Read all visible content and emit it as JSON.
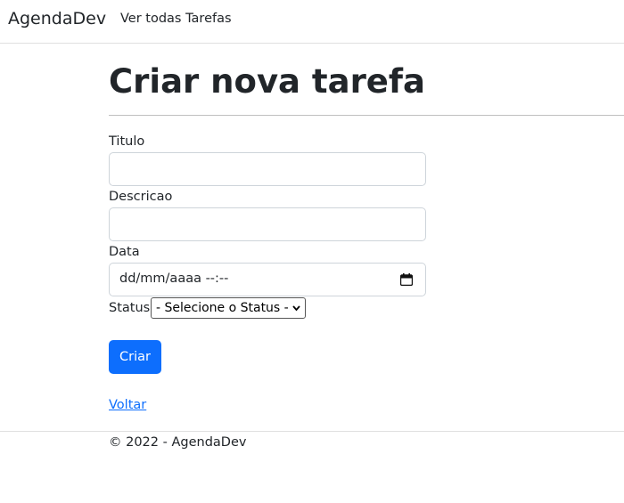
{
  "navbar": {
    "brand": "AgendaDev",
    "link": "Ver todas Tarefas"
  },
  "main": {
    "title": "Criar nova tarefa"
  },
  "form": {
    "titulo_label": "Titulo",
    "titulo_value": "",
    "descricao_label": "Descricao",
    "descricao_value": "",
    "data_label": "Data",
    "data_value": "dd/mm/aaaa --:--",
    "status_label": "Status",
    "status_selected": "- Selecione o Status -",
    "submit_label": "Criar",
    "back_link": "Voltar"
  },
  "footer": {
    "text": "© 2022 - AgendaDev"
  },
  "icons": {
    "date_picker": "calendar-icon",
    "dropdown": "chevron-down-icon"
  },
  "colors": {
    "primary": "#0d6efd",
    "text": "#212529",
    "border": "#ced4da"
  }
}
